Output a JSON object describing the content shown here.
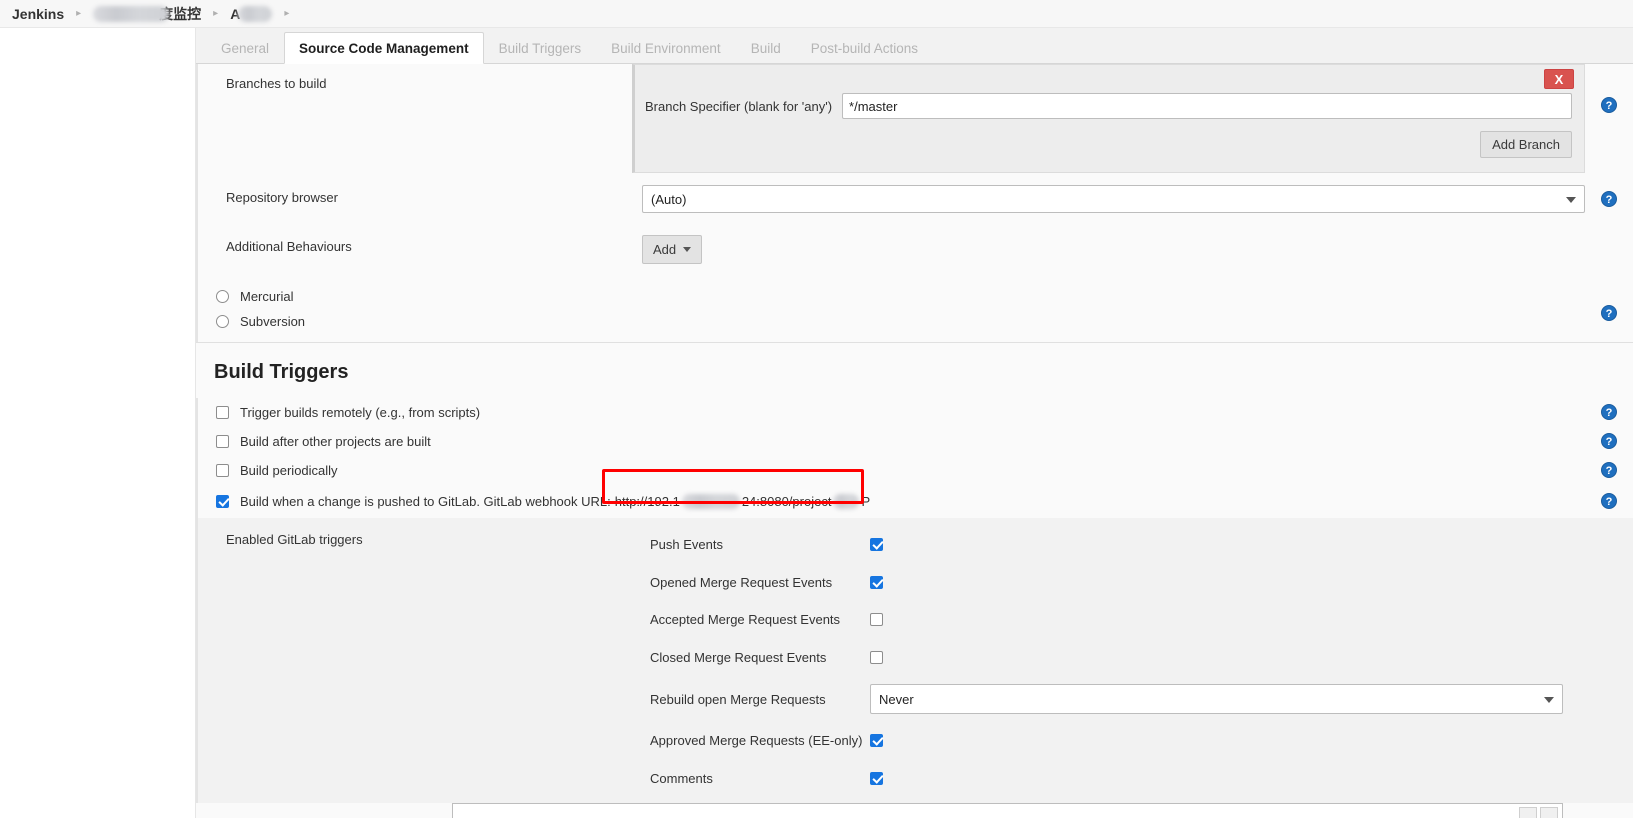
{
  "breadcrumb": {
    "root": "Jenkins",
    "separator": "▸",
    "items": [
      {
        "label": "度监控",
        "redacted_prefix": true,
        "redacted_width": 76
      },
      {
        "label": "A",
        "redacted_suffix": true,
        "redacted_width": 34
      }
    ]
  },
  "tabs": [
    {
      "label": "General",
      "active": false
    },
    {
      "label": "Source Code Management",
      "active": true
    },
    {
      "label": "Build Triggers",
      "active": false
    },
    {
      "label": "Build Environment",
      "active": false
    },
    {
      "label": "Build",
      "active": false
    },
    {
      "label": "Post-build Actions",
      "active": false
    }
  ],
  "scm": {
    "branches_label": "Branches to build",
    "remove_button": "X",
    "branch_specifier_label": "Branch Specifier (blank for 'any')",
    "branch_specifier_value": "*/master",
    "branch_specifier_placeholder": "",
    "add_branch_button": "Add Branch",
    "repository_browser_label": "Repository browser",
    "repository_browser_value": "(Auto)",
    "additional_behaviours_label": "Additional Behaviours",
    "add_button": "Add",
    "radios": [
      {
        "label": "Mercurial",
        "checked": false
      },
      {
        "label": "Subversion",
        "checked": false
      }
    ]
  },
  "build_triggers": {
    "title": "Build Triggers",
    "checkboxes": [
      {
        "label": "Trigger builds remotely (e.g., from scripts)",
        "checked": false
      },
      {
        "label": "Build after other projects are built",
        "checked": false
      },
      {
        "label": "Build periodically",
        "checked": false
      }
    ],
    "gitlab": {
      "label": "Build when a change is pushed to GitLab. GitLab webhook URL:",
      "checked": true,
      "url_prefix": "http://192.1",
      "url_mid": "24:8080/project",
      "url_suffix": "P",
      "highlight_color": "#ff0000"
    },
    "enabled_triggers_label": "Enabled GitLab triggers",
    "trigger_rows": [
      {
        "name": "Push Events",
        "type": "checkbox",
        "checked": true
      },
      {
        "name": "Opened Merge Request Events",
        "type": "checkbox",
        "checked": true
      },
      {
        "name": "Accepted Merge Request Events",
        "type": "checkbox",
        "checked": false
      },
      {
        "name": "Closed Merge Request Events",
        "type": "checkbox",
        "checked": false
      },
      {
        "name": "Rebuild open Merge Requests",
        "type": "select",
        "value": "Never"
      },
      {
        "name": "Approved Merge Requests (EE-only)",
        "type": "checkbox",
        "checked": true
      },
      {
        "name": "Comments",
        "type": "checkbox",
        "checked": true
      }
    ]
  },
  "icons": {
    "help": "?",
    "help_name": "help-icon"
  },
  "colors": {
    "accent_blue": "#1675e0",
    "help_blue": "#1f6fbf",
    "danger_red": "#d9534f",
    "highlight_red": "#ff0000",
    "panel_bg": "#f2f2f2",
    "page_bg": "#fafafa"
  }
}
